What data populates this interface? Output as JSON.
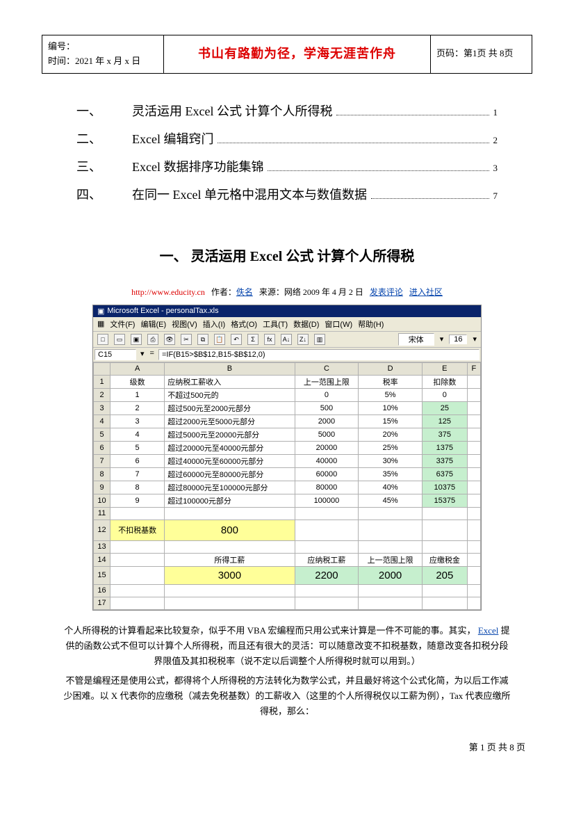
{
  "header": {
    "id_label": "编号：",
    "time_label": "时间：2021 年 x 月 x 日",
    "motto": "书山有路勤为径，学海无涯苦作舟",
    "page_label": "页码：第1页 共 8页"
  },
  "toc": [
    {
      "num": "一、",
      "title": "灵活运用 Excel 公式  计算个人所得税",
      "pg": "1"
    },
    {
      "num": "二、",
      "title": "Excel 编辑窍门",
      "pg": "2"
    },
    {
      "num": "三、",
      "title": "Excel 数据排序功能集锦",
      "pg": "3"
    },
    {
      "num": "四、",
      "title": "在同一 Excel 单元格中混用文本与数值数据",
      "pg": "7"
    }
  ],
  "section1": {
    "heading": "一、 灵活运用 Excel 公式  计算个人所得税",
    "meta_site": "http://www.educity.cn",
    "meta_author_lbl": "作者：",
    "meta_author": "佚名",
    "meta_source": "来源：网络   2009 年 4 月 2 日",
    "meta_comment": "发表评论",
    "meta_community": "进入社区"
  },
  "excel": {
    "title": "Microsoft Excel - personalTax.xls",
    "menus": [
      "文件(F)",
      "编辑(E)",
      "视图(V)",
      "插入(I)",
      "格式(O)",
      "工具(T)",
      "数据(D)",
      "窗口(W)",
      "帮助(H)"
    ],
    "font_name": "宋体",
    "font_size": "16",
    "cellref": "C15",
    "formula": "=IF(B15>$B$12,B15-$B$12,0)",
    "cols": [
      "",
      "A",
      "B",
      "C",
      "D",
      "E",
      "F"
    ],
    "header_row": [
      "1",
      "级数",
      "应纳税工薪收入",
      "上一范围上限",
      "税率",
      "扣除数",
      ""
    ],
    "rows": [
      [
        "2",
        "1",
        "不超过500元的",
        "0",
        "5%",
        "0",
        ""
      ],
      [
        "3",
        "2",
        "超过500元至2000元部分",
        "500",
        "10%",
        "25",
        ""
      ],
      [
        "4",
        "3",
        "超过2000元至5000元部分",
        "2000",
        "15%",
        "125",
        ""
      ],
      [
        "5",
        "4",
        "超过5000元至20000元部分",
        "5000",
        "20%",
        "375",
        ""
      ],
      [
        "6",
        "5",
        "超过20000元至40000元部分",
        "20000",
        "25%",
        "1375",
        ""
      ],
      [
        "7",
        "6",
        "超过40000元至60000元部分",
        "40000",
        "30%",
        "3375",
        ""
      ],
      [
        "8",
        "7",
        "超过60000元至80000元部分",
        "60000",
        "35%",
        "6375",
        ""
      ],
      [
        "9",
        "8",
        "超过80000元至100000元部分",
        "80000",
        "40%",
        "10375",
        ""
      ],
      [
        "10",
        "9",
        "超过100000元部分",
        "100000",
        "45%",
        "15375",
        ""
      ]
    ],
    "row11": [
      "11",
      "",
      "",
      "",
      "",
      "",
      ""
    ],
    "row12": [
      "12",
      "不扣税基数",
      "800",
      "",
      "",
      "",
      ""
    ],
    "row13": [
      "13",
      "",
      "",
      "",
      "",
      "",
      ""
    ],
    "row14": [
      "14",
      "",
      "所得工薪",
      "应纳税工薪",
      "上一范围上限",
      "应缴税金",
      ""
    ],
    "row15": [
      "15",
      "",
      "3000",
      "2200",
      "2000",
      "205",
      ""
    ],
    "row16": [
      "16",
      "",
      "",
      "",
      "",
      "",
      ""
    ],
    "row17": [
      "17",
      "",
      "",
      "",
      "",
      "",
      ""
    ]
  },
  "paras": {
    "p1a": "个人所得税的计算看起来比较复杂，似乎不用 VBA 宏编程而只用公式来计算是一件不可能的事。其实，",
    "p1_link": "Excel",
    "p1b": " 提供的函数公式不但可以计算个人所得税，而且还有很大的灵活：可以随意改变不扣税基数，随意改变各扣税分段界限值及其扣税税率（说不定以后调整个人所得税时就可以用到。）",
    "p2": "不管是编程还是使用公式，都得将个人所得税的方法转化为数学公式，并且最好将这个公式化简，为以后工作减少困难。以 X 代表你的应缴税（减去免税基数）的工薪收入（这里的个人所得税仅以工薪为例），Tax 代表应缴所得税，那么："
  },
  "footer": "第 1 页 共 8 页"
}
